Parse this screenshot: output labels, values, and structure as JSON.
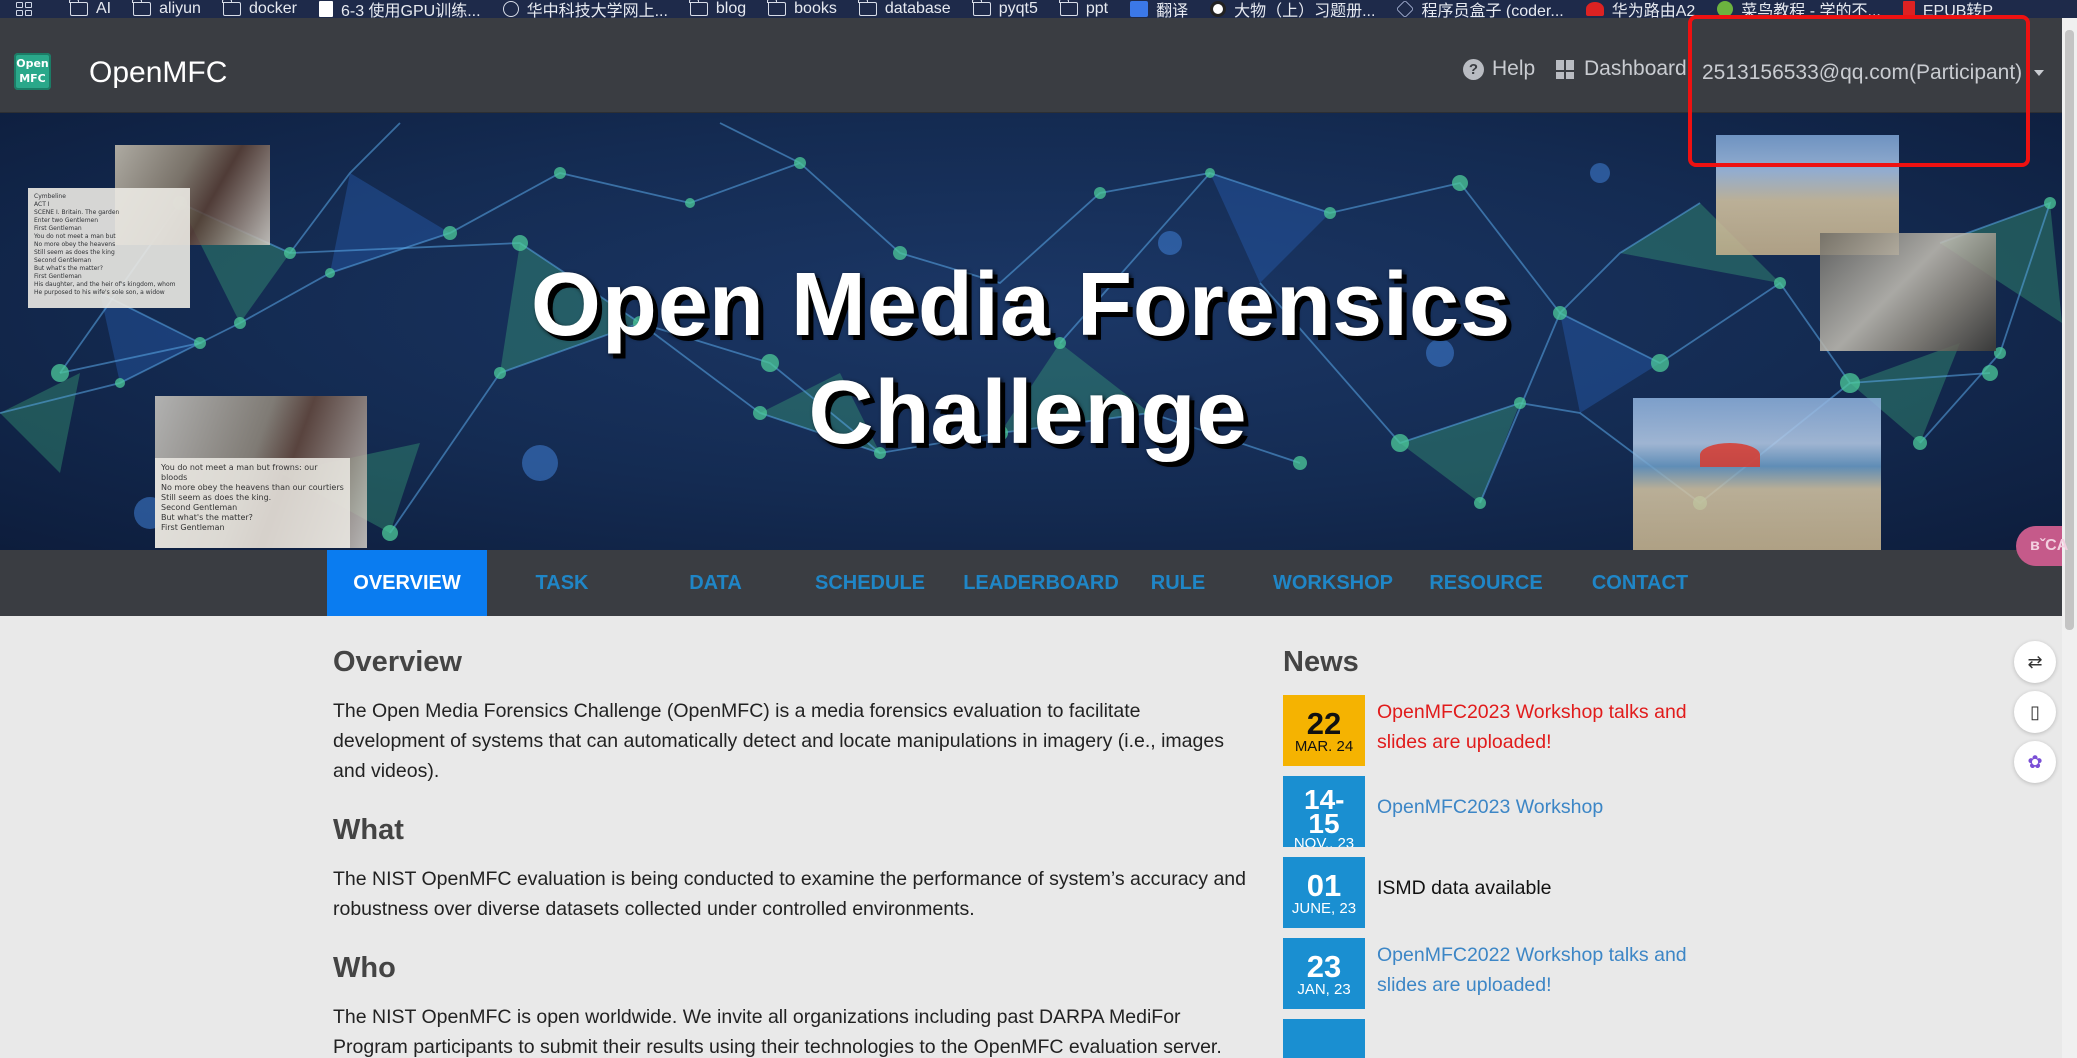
{
  "bookmarks": [
    {
      "label": "AI",
      "icon": "folder-icon"
    },
    {
      "label": "aliyun",
      "icon": "folder-icon"
    },
    {
      "label": "docker",
      "icon": "folder-icon"
    },
    {
      "label": "6-3 使用GPU训练...",
      "icon": "page-icon"
    },
    {
      "label": "华中科技大学网上...",
      "icon": "globe-icon"
    },
    {
      "label": "blog",
      "icon": "folder-icon"
    },
    {
      "label": "books",
      "icon": "folder-icon"
    },
    {
      "label": "database",
      "icon": "folder-icon"
    },
    {
      "label": "pyqt5",
      "icon": "folder-icon"
    },
    {
      "label": "ppt",
      "icon": "folder-icon"
    },
    {
      "label": "翻译",
      "icon": "translate-icon"
    },
    {
      "label": "大物（上）习题册...",
      "icon": "site-icon"
    },
    {
      "label": "程序员盒子 (coder...",
      "icon": "hex-icon"
    },
    {
      "label": "华为路由A2",
      "icon": "huawei-icon"
    },
    {
      "label": "菜鸟教程 - 学的不...",
      "icon": "runoob-icon"
    },
    {
      "label": "EPUB转P",
      "icon": "epub-icon"
    }
  ],
  "navbar": {
    "logo_text_top": "Open",
    "logo_text_bottom": "MFC",
    "brand": "OpenMFC",
    "help": "Help",
    "dashboard": "Dashboard",
    "user": "2513156533@qq.com(Participant)"
  },
  "hero": {
    "title_line1": "Open Media Forensics",
    "title_line2": "Challenge",
    "photo_text_left_top": "Cymbeline\nACT I\nSCENE I. Britain. The garden\nEnter two Gentlemen\nFirst Gentleman\nYou do not meet a man but\nNo more obey the heavens\nStill seem as does the king\nSecond Gentleman\nBut what's the matter?\nFirst Gentleman\nHis daughter, and the heir of's kingdom, whom\nHe purposed to his wife's sole son, a widow",
    "photo_text_left_bottom": "You do not meet a man but frowns: our bloods\nNo more obey the heavens than our courtiers\nStill seem as does the king.\nSecond Gentleman\nBut what's the matter?\nFirst Gentleman"
  },
  "tabs": [
    {
      "label": "OVERVIEW",
      "active": true
    },
    {
      "label": "TASK",
      "active": false
    },
    {
      "label": "DATA",
      "active": false
    },
    {
      "label": "SCHEDULE",
      "active": false
    },
    {
      "label": "LEADERBOARD",
      "active": false
    },
    {
      "label": "RULE",
      "active": false
    },
    {
      "label": "WORKSHOP",
      "active": false
    },
    {
      "label": "RESOURCE",
      "active": false
    },
    {
      "label": "CONTACT",
      "active": false
    }
  ],
  "overview": {
    "heading": "Overview",
    "text": "The Open Media Forensics Challenge (OpenMFC) is a media forensics evaluation to facilitate development of systems that can automatically detect and locate manipulations in imagery (i.e., images and videos).",
    "what_heading": "What",
    "what_text": "The NIST OpenMFC evaluation is being conducted to examine the performance of system’s accuracy and robustness over diverse datasets collected under controlled environments.",
    "who_heading": "Who",
    "who_text": "The NIST OpenMFC is open worldwide. We invite all organizations including past DARPA MediFor Program participants to submit their results using their technologies to the OpenMFC evaluation server."
  },
  "news": {
    "heading": "News",
    "items": [
      {
        "day": "22",
        "month": "MAR. 24",
        "text": "OpenMFC2023 Workshop talks and slides are uploaded!",
        "style": "red",
        "color": "#f5b301"
      },
      {
        "day": "14-15",
        "month": "NOV., 23",
        "text": "OpenMFC2023 Workshop",
        "style": "link",
        "color": "#1a8fd1"
      },
      {
        "day": "01",
        "month": "JUNE, 23",
        "text": "ISMD data available",
        "style": "plain",
        "color": "#1a8fd1"
      },
      {
        "day": "23",
        "month": "JAN, 23",
        "text": "OpenMFC2022 Workshop talks and slides are uploaded!",
        "style": "link",
        "color": "#1a8fd1"
      }
    ]
  },
  "side": {
    "float_label": "вˇCA",
    "buttons": [
      "translate-icon",
      "book-icon",
      "brain-icon"
    ]
  },
  "colors": {
    "navbar_bg": "#3a3d42",
    "tab_active": "#0a7cf0",
    "tab_text": "#1f86c7",
    "news_red": "#e11b1b",
    "news_link": "#3c86c6",
    "date_blue": "#1a8fd1",
    "date_yellow": "#f5b301",
    "highlight": "#ee1111"
  }
}
